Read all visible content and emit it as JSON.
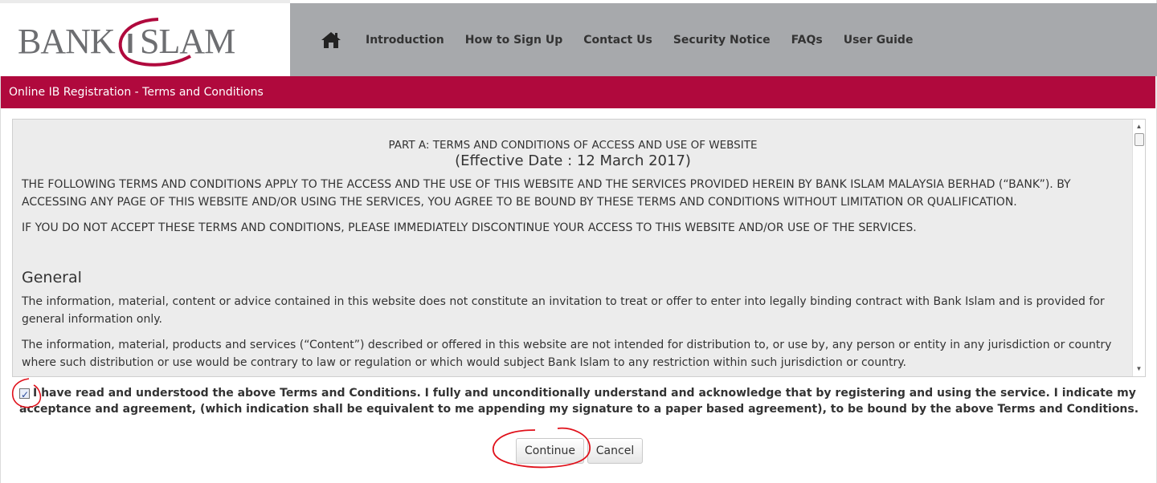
{
  "brand": {
    "logo_text": "BANK ISLAM",
    "logo_color": "#6d6e71",
    "logo_swoosh_color": "#b0093d"
  },
  "nav": {
    "home_icon": "home-icon",
    "items": [
      {
        "label": "Introduction"
      },
      {
        "label": "How to Sign Up"
      },
      {
        "label": "Contact Us"
      },
      {
        "label": "Security Notice"
      },
      {
        "label": "FAQs"
      },
      {
        "label": "User Guide"
      }
    ],
    "background": "#a7a9ac"
  },
  "title_bar": {
    "text": "Online IB Registration - Terms and Conditions",
    "background": "#b0093d"
  },
  "terms": {
    "heading": "PART A: TERMS AND CONDITIONS OF ACCESS AND USE OF WEBSITE",
    "effective": "(Effective Date : 12 March 2017)",
    "intro_1": "THE FOLLOWING TERMS AND CONDITIONS APPLY TO THE ACCESS AND THE USE OF THIS WEBSITE AND THE SERVICES PROVIDED HEREIN BY BANK ISLAM MALAYSIA BERHAD (“BANK”). BY ACCESSING ANY PAGE OF THIS WEBSITE AND/OR USING THE SERVICES, YOU AGREE TO BE BOUND BY THESE TERMS AND CONDITIONS WITHOUT LIMITATION OR QUALIFICATION.",
    "intro_2": "IF YOU DO NOT ACCEPT THESE TERMS AND CONDITIONS, PLEASE IMMEDIATELY DISCONTINUE YOUR ACCESS TO THIS WEBSITE AND/OR USE OF THE SERVICES.",
    "section_general": "General",
    "general_1": "The information, material, content or advice contained in this website does not constitute an invitation to treat or offer to enter into legally binding contract with Bank Islam and is provided for general information only.",
    "general_2": "The information, material, products and services (“Content”) described or offered in this website are not intended for distribution to, or use by, any person or entity in any jurisdiction or country where such distribution or use would be contrary to law or regulation or which would subject Bank Islam to any restriction within such jurisdiction or country."
  },
  "agreement": {
    "checked": true,
    "text": "I have read and understood the above Terms and Conditions. I fully and unconditionally understand and acknowledge that by registering and using the service. I indicate my acceptance and agreement, (which indication shall be equivalent to me appending my signature to a paper based agreement), to be bound by the above Terms and Conditions."
  },
  "buttons": {
    "continue": "Continue",
    "cancel": "Cancel"
  },
  "annotation_color": "#e0101a"
}
